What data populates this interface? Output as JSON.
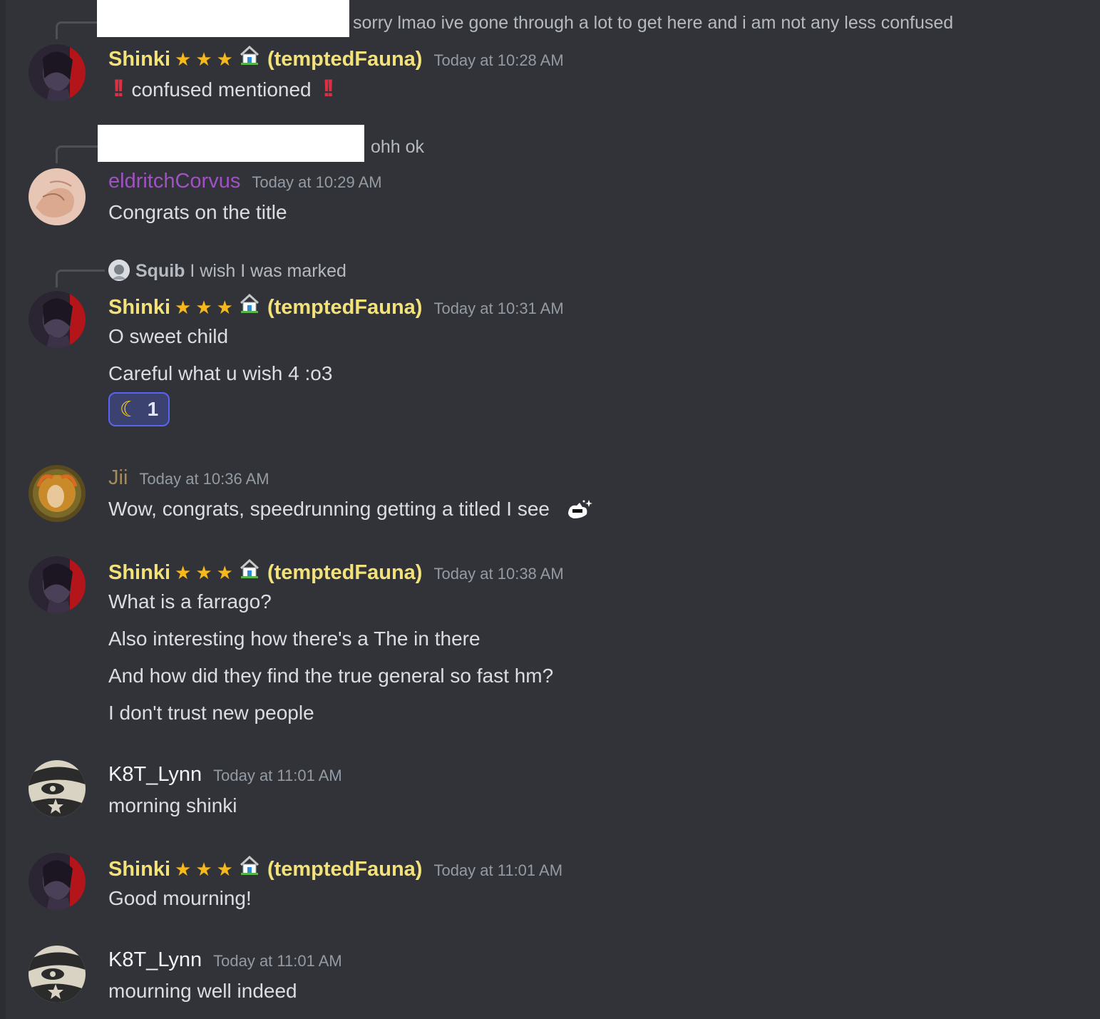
{
  "colors": {
    "background": "#313338",
    "shinki_name": "#f3e27a",
    "corvus_name": "#9b59b6",
    "jii_name": "#a48b5c",
    "lynn_name": "#f2f3f5",
    "timestamp": "#949ba4",
    "reaction_border": "#5865f2"
  },
  "messages": [
    {
      "reply": {
        "redacted": true,
        "text": "sorry lmao ive gone through a lot to get here and i am not any less confused"
      },
      "author": "Shinki",
      "author_suffix": "(temptedFauna)",
      "badges": [
        "star",
        "star",
        "star",
        "house"
      ],
      "timestamp": "Today at 10:28 AM",
      "lines": [
        "confused mentioned"
      ],
      "line_decoration": "double-exclamation-icon"
    },
    {
      "reply": {
        "redacted": true,
        "text": "ohh ok"
      },
      "author": "eldritchCorvus",
      "timestamp": "Today at 10:29 AM",
      "lines": [
        "Congrats on the title"
      ]
    },
    {
      "reply": {
        "name": "Squib",
        "text": "I wish I was marked"
      },
      "author": "Shinki",
      "author_suffix": "(temptedFauna)",
      "badges": [
        "star",
        "star",
        "star",
        "house"
      ],
      "timestamp": "Today at 10:31 AM",
      "lines": [
        "O sweet child",
        "Careful what u wish 4 :o3"
      ],
      "reaction": {
        "icon": "crescent-moon-icon",
        "count": "1"
      }
    },
    {
      "author": "Jii",
      "timestamp": "Today at 10:36 AM",
      "lines": [
        "Wow, congrats, speedrunning getting a titled I see"
      ],
      "trailing_emoji": "sparkle-face-icon"
    },
    {
      "author": "Shinki",
      "author_suffix": "(temptedFauna)",
      "badges": [
        "star",
        "star",
        "star",
        "house"
      ],
      "timestamp": "Today at 10:38 AM",
      "lines": [
        "What is a farrago?",
        "Also interesting how there's a The in there",
        "And how did they find the true general so fast hm?",
        "I don't trust new people"
      ]
    },
    {
      "author": "K8T_Lynn",
      "timestamp": "Today at 11:01 AM",
      "lines": [
        "morning shinki"
      ]
    },
    {
      "author": "Shinki",
      "author_suffix": "(temptedFauna)",
      "badges": [
        "star",
        "star",
        "star",
        "house"
      ],
      "timestamp": "Today at 11:01 AM",
      "lines": [
        "Good mourning!"
      ]
    },
    {
      "author": "K8T_Lynn",
      "timestamp": "Today at 11:01 AM",
      "lines": [
        "mourning well indeed"
      ]
    }
  ],
  "glyphs": {
    "star": "★",
    "moon": "☾"
  }
}
